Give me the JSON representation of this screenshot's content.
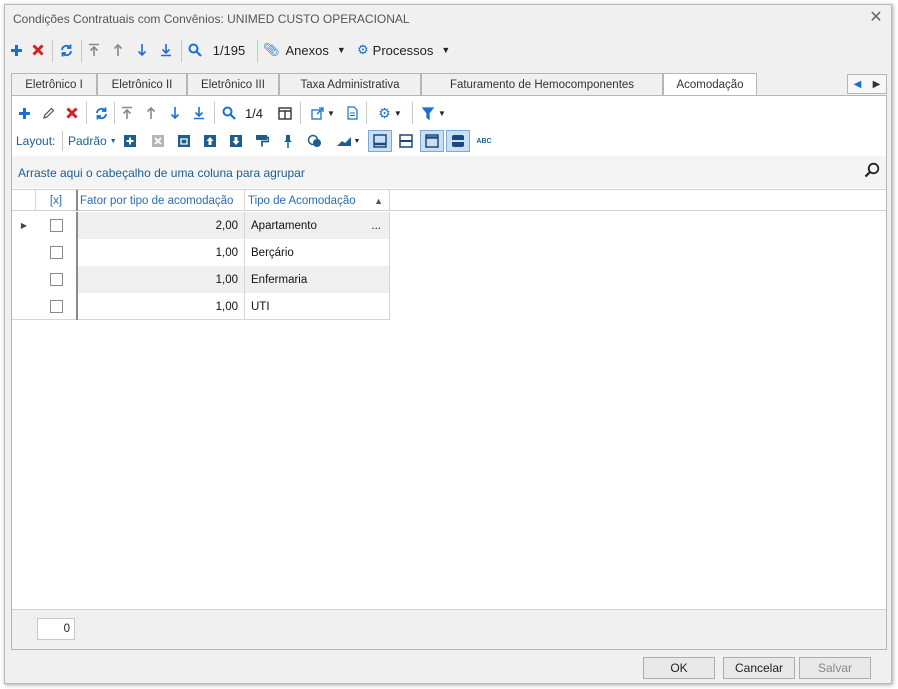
{
  "window": {
    "title": "Condições Contratuais com Convênios: UNIMED CUSTO OPERACIONAL"
  },
  "toolbar": {
    "record_position": "1/195",
    "anexos_label": "Anexos",
    "processos_label": "Processos"
  },
  "tabs": [
    {
      "label": "Eletrônico I"
    },
    {
      "label": "Eletrônico II"
    },
    {
      "label": "Eletrônico III"
    },
    {
      "label": "Taxa Administrativa"
    },
    {
      "label": "Faturamento de Hemocomponentes"
    },
    {
      "label": "Acomodação",
      "active": true
    }
  ],
  "subtoolbar": {
    "record_position": "1/4"
  },
  "layoutbar": {
    "layout_label": "Layout:",
    "layout_value": "Padrão"
  },
  "group_hint": "Arraste aqui o cabeçalho de uma coluna para agrupar",
  "grid": {
    "columns": {
      "select": "[x]",
      "fator": "Fator por tipo de acomodação",
      "tipo": "Tipo de Acomodação"
    },
    "rows": [
      {
        "fator": "2,00",
        "tipo": "Apartamento",
        "ellipsis": "..."
      },
      {
        "fator": "1,00",
        "tipo": "Berçário"
      },
      {
        "fator": "1,00",
        "tipo": "Enfermaria"
      },
      {
        "fator": "1,00",
        "tipo": "UTI"
      }
    ]
  },
  "footer": {
    "count": "0"
  },
  "buttons": {
    "ok": "OK",
    "cancel": "Cancelar",
    "save": "Salvar"
  },
  "colors": {
    "accent": "#1a6fd1",
    "delete": "#d32020",
    "link": "#1c5f8e"
  }
}
